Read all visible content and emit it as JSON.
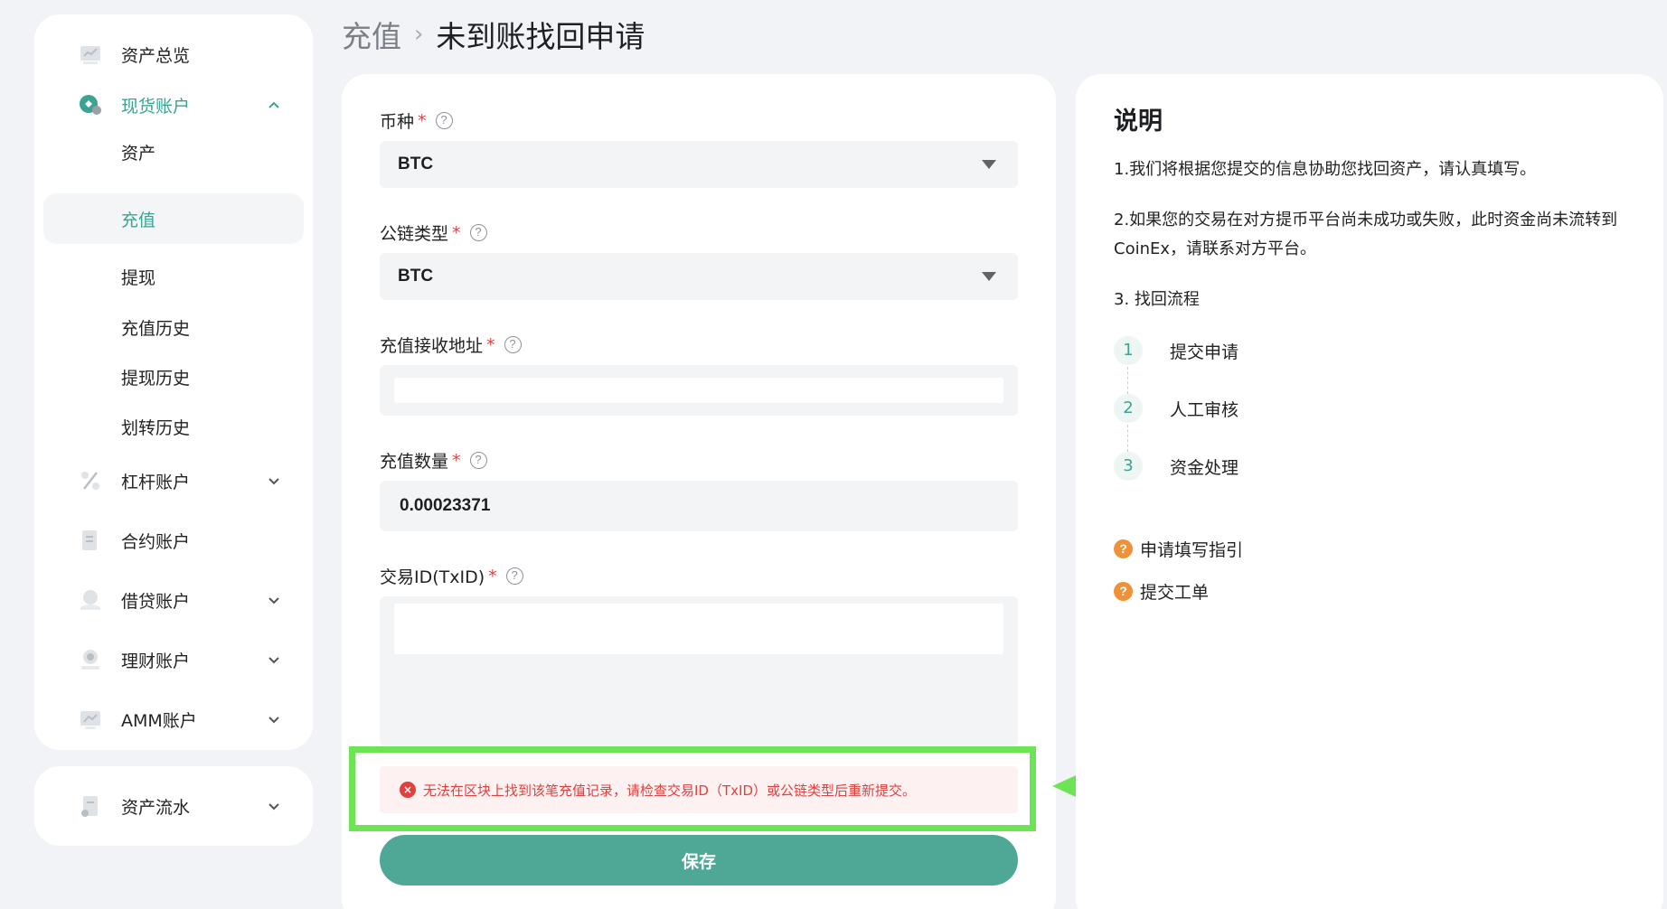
{
  "breadcrumb": {
    "parent": "充值",
    "separator": "›",
    "current": "未到账找回申请"
  },
  "sidebar": {
    "items": [
      {
        "label": "资产总览",
        "icon": "chart-card-icon"
      },
      {
        "label": "现货账户",
        "icon": "spot-coin-icon",
        "expanded": true
      },
      {
        "label": "杠杆账户",
        "icon": "percent-icon"
      },
      {
        "label": "合约账户",
        "icon": "document-icon"
      },
      {
        "label": "借贷账户",
        "icon": "loan-hand-icon"
      },
      {
        "label": "理财账户",
        "icon": "savings-icon"
      },
      {
        "label": "AMM账户",
        "icon": "amm-chart-icon"
      }
    ],
    "sub_items": [
      {
        "label": "资产"
      },
      {
        "label": "充值",
        "selected": true
      },
      {
        "label": "提现"
      },
      {
        "label": "充值历史"
      },
      {
        "label": "提现历史"
      },
      {
        "label": "划转历史"
      }
    ],
    "bottom_item": {
      "label": "资产流水",
      "icon": "ledger-icon"
    }
  },
  "form": {
    "coin": {
      "label": "币种",
      "required_mark": "*",
      "value": "BTC"
    },
    "chain": {
      "label": "公链类型",
      "required_mark": "*",
      "value": "BTC"
    },
    "address": {
      "label": "充值接收地址",
      "required_mark": "*",
      "value": ""
    },
    "amount": {
      "label": "充值数量",
      "required_mark": "*",
      "value": "0.00023371"
    },
    "txid": {
      "label": "交易ID(TxID)",
      "required_mark": "*",
      "value": ""
    },
    "help_glyph": "?",
    "error": {
      "icon": "error-circle-icon",
      "glyph": "×",
      "text": "无法在区块上找到该笔充值记录，请检查交易ID（TxID）或公链类型后重新提交。"
    },
    "save_label": "保存"
  },
  "info": {
    "title": "说明",
    "p1": "1.我们将根据您提交的信息协助您找回资产，请认真填写。",
    "p2": "2.如果您的交易在对方提币平台尚未成功或失败，此时资金尚未流转到CoinEx，请联系对方平台。",
    "p3": "3. 找回流程",
    "steps": [
      {
        "num": "1",
        "label": "提交申请"
      },
      {
        "num": "2",
        "label": "人工审核"
      },
      {
        "num": "3",
        "label": "资金处理"
      }
    ],
    "links": [
      {
        "label": "申请填写指引",
        "glyph": "?"
      },
      {
        "label": "提交工单",
        "glyph": "?"
      }
    ]
  },
  "colors": {
    "accent": "#3aa394",
    "button": "#4fa896",
    "error": "#e0413e",
    "highlight": "#6de356",
    "help_orange": "#f0913a"
  }
}
